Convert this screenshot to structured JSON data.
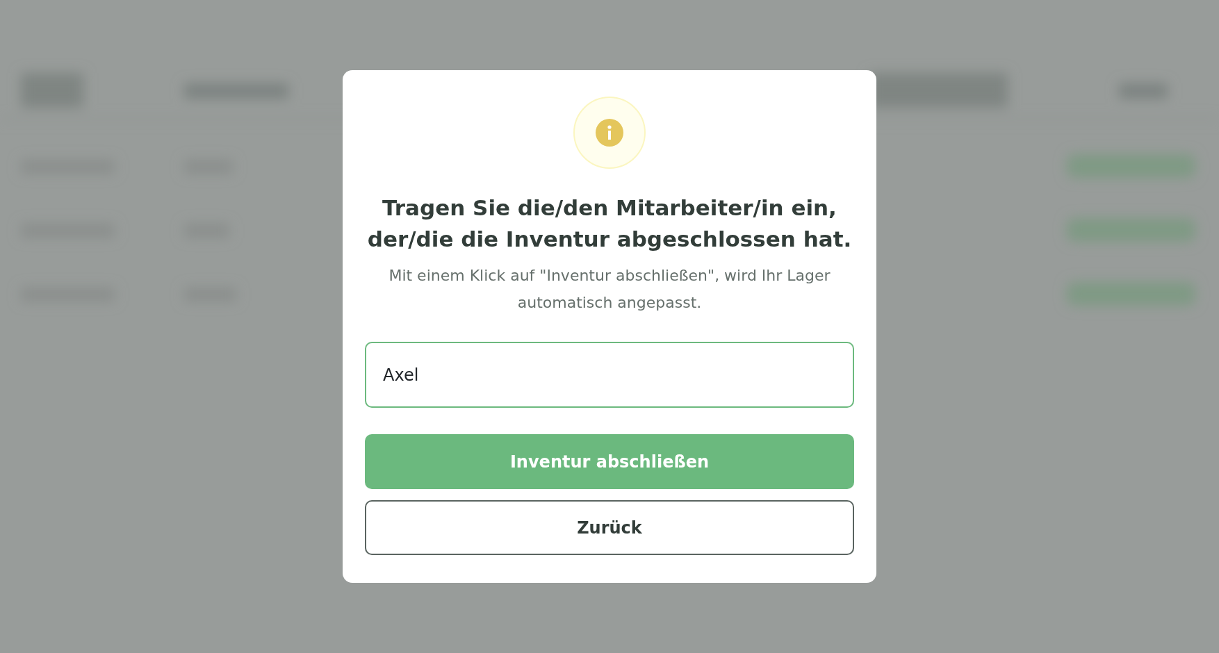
{
  "dialog": {
    "title": "Tragen Sie die/den Mitarbeiter/in ein, der/die die Inventur abgeschlossen hat.",
    "message": "Mit einem Klick auf \"Inventur abschließen\", wird Ihr Lager automatisch angepasst.",
    "employee_field": {
      "value": "Axel"
    },
    "buttons": [
      {
        "label": "Inventur abschließen",
        "kind": "primary"
      },
      {
        "label": "Zurück",
        "kind": "secondary"
      }
    ]
  }
}
